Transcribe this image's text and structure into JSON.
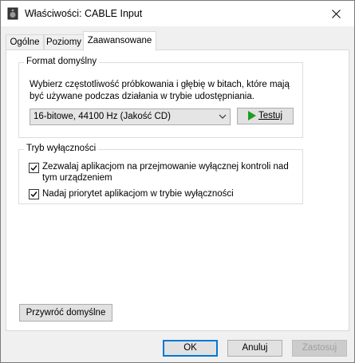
{
  "window": {
    "title": "Właściwości: CABLE Input"
  },
  "tabs": [
    {
      "label": "Ogólne"
    },
    {
      "label": "Poziomy"
    },
    {
      "label": "Zaawansowane"
    }
  ],
  "default_format": {
    "group_label": "Format domyślny",
    "description": "Wybierz częstotliwość próbkowania i głębię w bitach, które mają być używane podczas działania w trybie udostępniania.",
    "selected_format": "16-bitowe, 44100 Hz (Jakość CD)",
    "test_label": "Testuj"
  },
  "exclusive_mode": {
    "group_label": "Tryb wyłączności",
    "options": [
      {
        "label_line1": "Zezwalaj aplikacjom na przejmowanie wyłącznej kontroli nad",
        "label_line2": "tym urządzeniem",
        "checked": true
      },
      {
        "label_line1": "Nadaj priorytet aplikacjom w trybie wyłączności",
        "checked": true
      }
    ]
  },
  "restore_defaults_label": "Przywróć domyślne",
  "footer": {
    "ok_label": "OK",
    "cancel_label": "Anuluj",
    "apply_label": "Zastosuj"
  },
  "colors": {
    "accent": "#0078d7",
    "play_green": "#1e9e1e"
  },
  "icons": {
    "window": "speaker-icon",
    "close": "close-icon",
    "test": "play-icon",
    "dropdown": "chevron-down-icon",
    "check": "check-icon"
  }
}
